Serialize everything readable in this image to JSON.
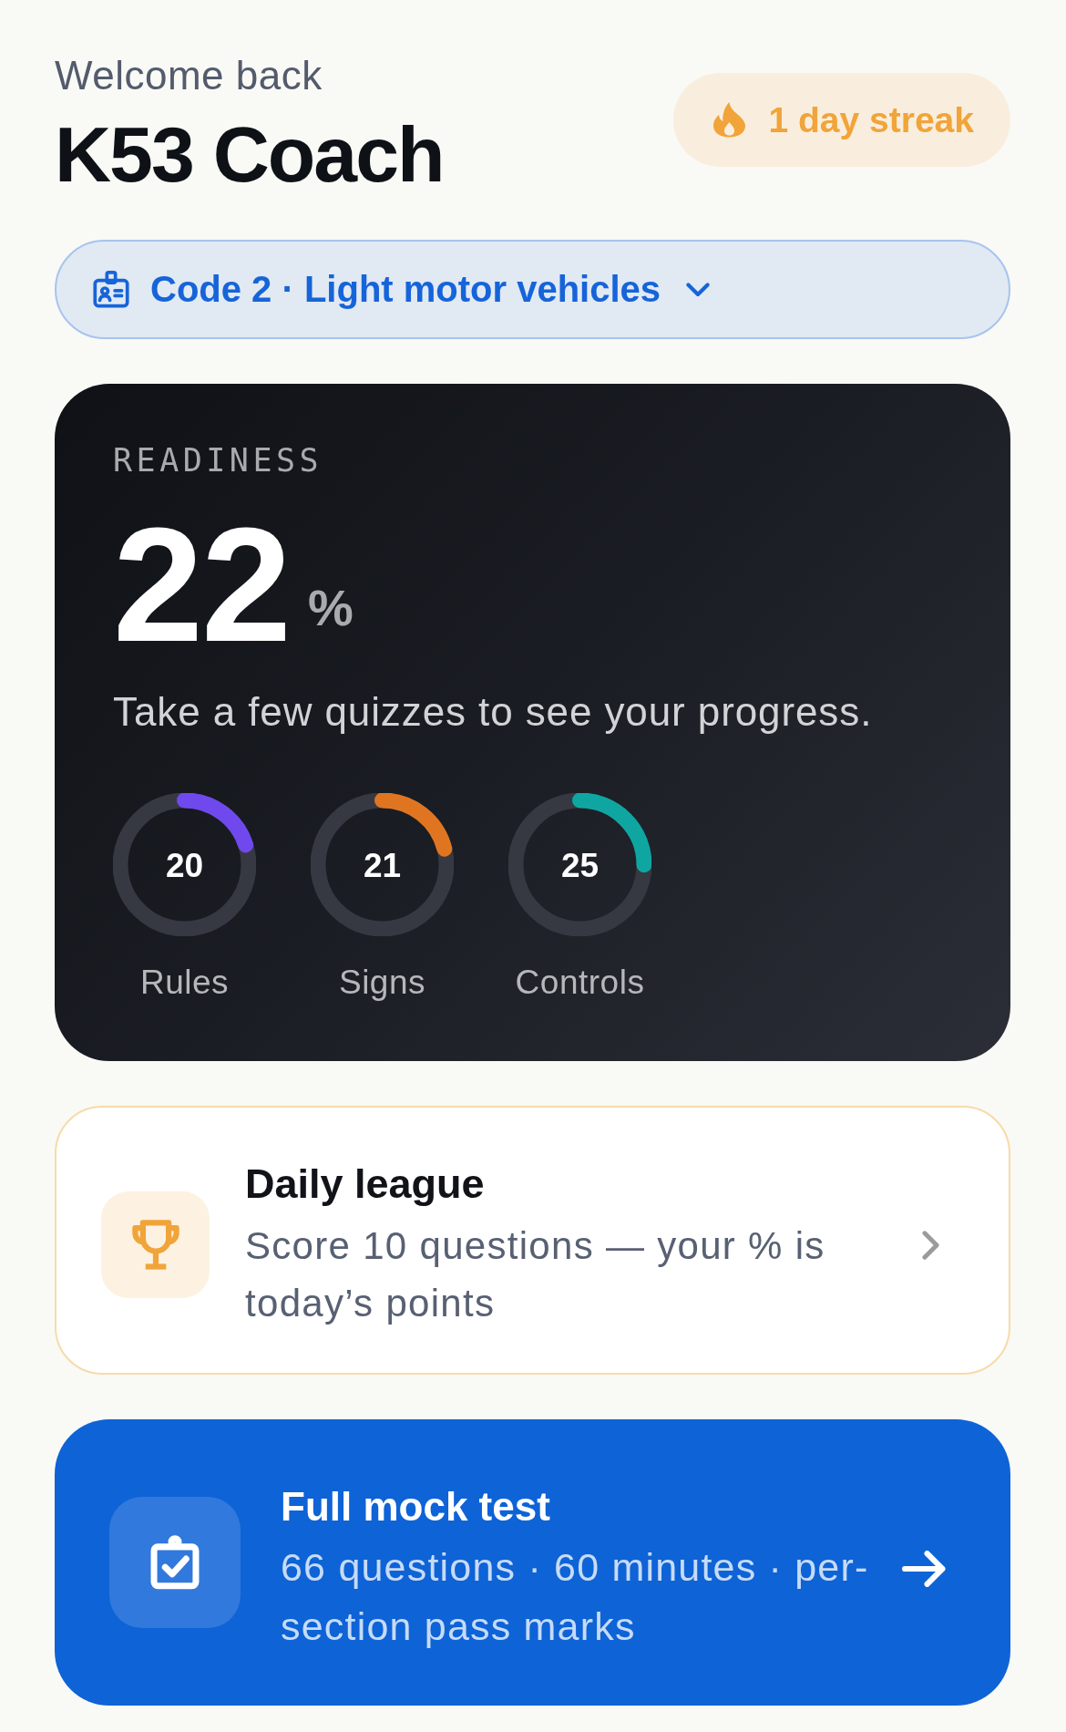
{
  "header": {
    "greeting": "Welcome back",
    "title": "K53 Coach",
    "streak": "1 day streak"
  },
  "licence_code": {
    "label": "Code 2 · Light motor vehicles"
  },
  "readiness": {
    "label": "READINESS",
    "value": "22",
    "unit": "%",
    "message": "Take a few quizzes to see your progress.",
    "sections": [
      {
        "name": "Rules",
        "score": "20",
        "level": 0.2,
        "color": "#7049ee"
      },
      {
        "name": "Signs",
        "score": "21",
        "level": 0.21,
        "color": "#e07521"
      },
      {
        "name": "Controls",
        "score": "25",
        "level": 0.25,
        "color": "#0fa6a2"
      }
    ]
  },
  "daily_league": {
    "title": "Daily league",
    "description": "Score 10 questions — your % is today’s points"
  },
  "mock_test": {
    "title": "Full mock test",
    "description": "66 questions · 60 minutes · per-section pass marks"
  }
}
